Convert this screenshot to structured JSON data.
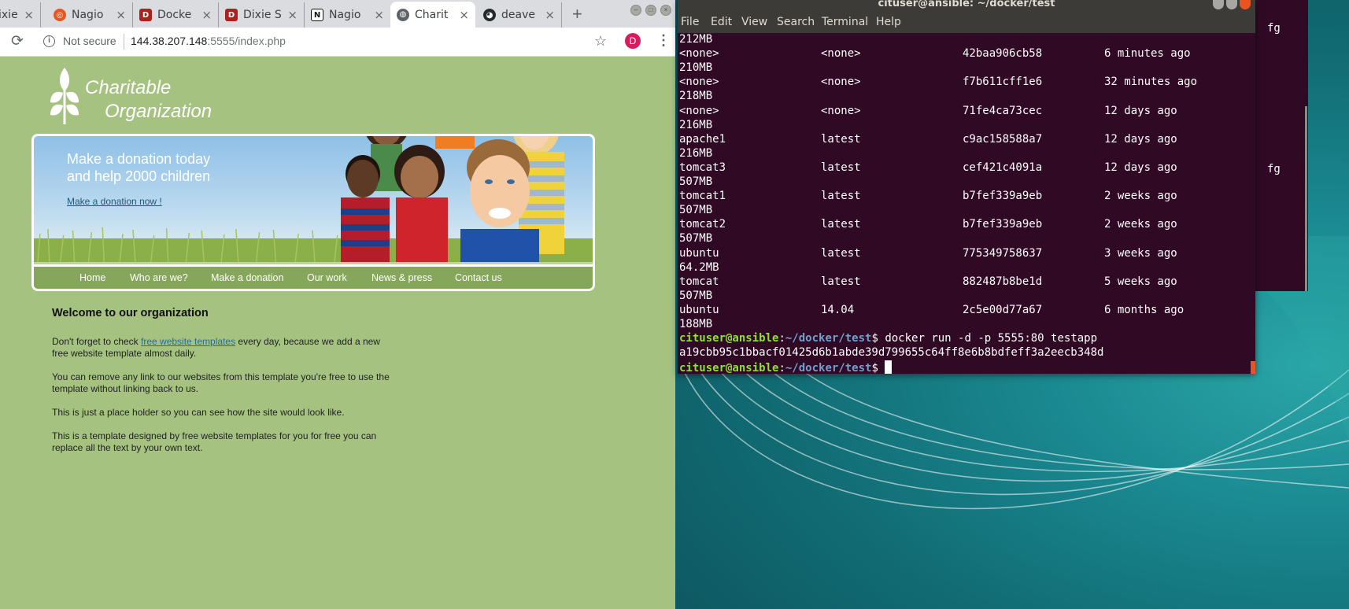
{
  "browser": {
    "tabs": [
      {
        "title": "ixie S",
        "favicon": "dixie-favicon"
      },
      {
        "title": "Nagio",
        "favicon": "ubuntu-favicon"
      },
      {
        "title": "Docke",
        "favicon": "dixie-favicon"
      },
      {
        "title": "Dixie S",
        "favicon": "dixie-favicon"
      },
      {
        "title": "Nagio",
        "favicon": "notion-favicon"
      },
      {
        "title": "Charit",
        "favicon": "globe-favicon",
        "active": true
      },
      {
        "title": "deave",
        "favicon": "github-favicon"
      }
    ],
    "close_glyph": "×",
    "new_tab_glyph": "+",
    "security_label": "Not secure",
    "url_host": "144.38.207.148",
    "url_rest": ":5555/index.php",
    "profile_initial": "D",
    "profile_color": "#d81b60"
  },
  "site": {
    "logo_line1": "Charitable",
    "logo_line2": "Organization",
    "banner_line1": "Make a donation today",
    "banner_line2": "and help 2000 children",
    "banner_link": "Make a donation now !",
    "nav": [
      "Home",
      "Who are we?",
      "Make a donation",
      "Our work",
      "News & press",
      "Contact us"
    ],
    "welcome_title": "Welcome to our organization",
    "para1_a": "Don't forget to check ",
    "para1_link": "free website templates",
    "para1_b": " every day, because we add a new free website template almost daily.",
    "para2": "You can remove any link to our websites from this template you're free to use the template without linking back to us.",
    "para3": "This is just a place holder so you can see how the site would look like.",
    "para4": "This is a template designed by free website templates for you for free you can replace all the text by your own text.",
    "bg_color": "#a5c281",
    "nav_color": "#86a65c"
  },
  "terminal": {
    "title": "cituser@ansible: ~/docker/test",
    "menu": [
      "File",
      "Edit",
      "View",
      "Search",
      "Terminal",
      "Help"
    ],
    "top_size": "212MB",
    "images": [
      {
        "repo": "<none>",
        "tag": "<none>",
        "id": "42baa906cb58",
        "created": "6 minutes ago",
        "size": "210MB"
      },
      {
        "repo": "<none>",
        "tag": "<none>",
        "id": "f7b611cff1e6",
        "created": "32 minutes ago",
        "size": "218MB"
      },
      {
        "repo": "<none>",
        "tag": "<none>",
        "id": "71fe4ca73cec",
        "created": "12 days ago",
        "size": "216MB"
      },
      {
        "repo": "apache1",
        "tag": "latest",
        "id": "c9ac158588a7",
        "created": "12 days ago",
        "size": "216MB"
      },
      {
        "repo": "tomcat3",
        "tag": "latest",
        "id": "cef421c4091a",
        "created": "12 days ago",
        "size": "507MB"
      },
      {
        "repo": "tomcat1",
        "tag": "latest",
        "id": "b7fef339a9eb",
        "created": "2 weeks ago",
        "size": "507MB"
      },
      {
        "repo": "tomcat2",
        "tag": "latest",
        "id": "b7fef339a9eb",
        "created": "2 weeks ago",
        "size": "507MB"
      },
      {
        "repo": "ubuntu",
        "tag": "latest",
        "id": "775349758637",
        "created": "3 weeks ago",
        "size": "64.2MB"
      },
      {
        "repo": "tomcat",
        "tag": "latest",
        "id": "882487b8be1d",
        "created": "5 weeks ago",
        "size": "507MB"
      },
      {
        "repo": "ubuntu",
        "tag": "14.04",
        "id": "2c5e00d77a67",
        "created": "6 months ago",
        "size": "188MB"
      }
    ],
    "prompt_user": "cituser@ansible",
    "prompt_path": "~/docker/test",
    "prompt_symbol": "$",
    "command": " docker run -d -p 5555:80 testapp",
    "container_id": "a19cbb95c1bbacf01425d6b1abde39d799655c64ff8e6b8bdfeff3a2eecb348d",
    "prompt_color": "#8ae234",
    "path_color": "#729fcf",
    "background": "#300a24"
  },
  "terminal2": {
    "fragment1": "fg",
    "fragment2": "fg"
  }
}
